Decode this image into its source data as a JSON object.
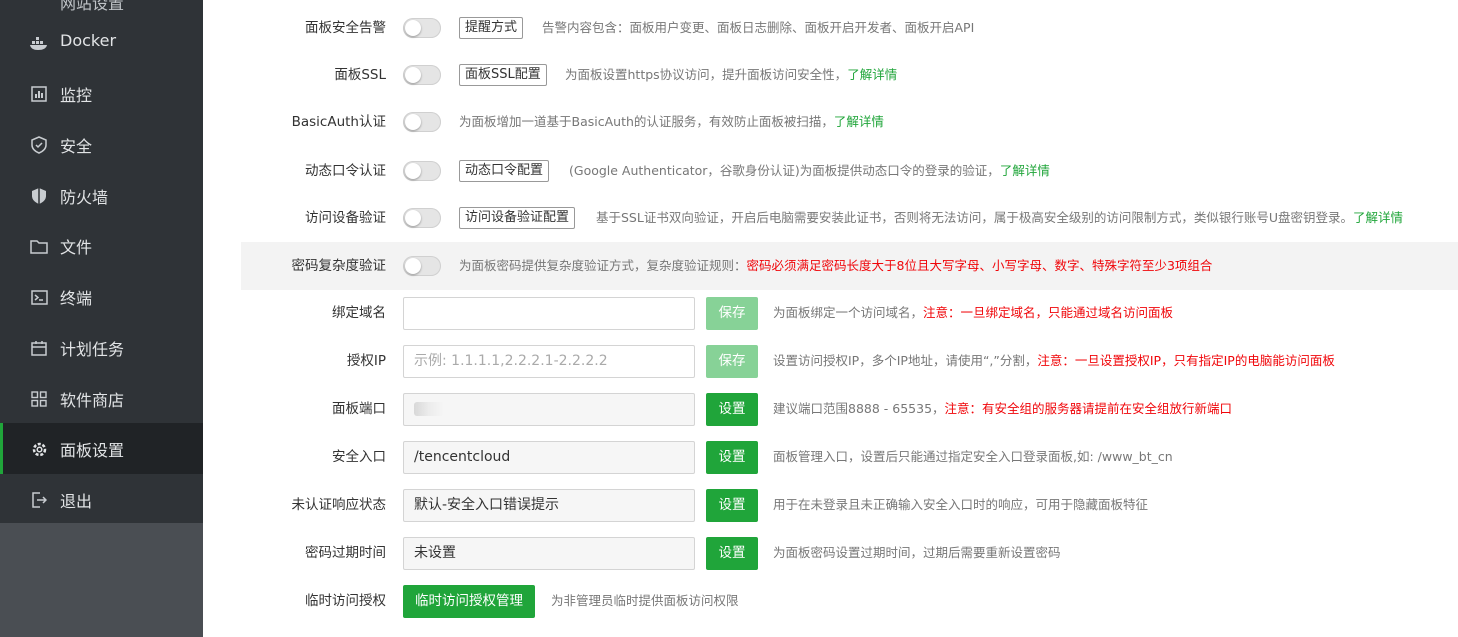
{
  "sidebar": {
    "top_partial": "网站设置",
    "items": [
      {
        "label": "Docker",
        "icon": "docker-icon"
      },
      {
        "label": "监控",
        "icon": "monitor-icon"
      },
      {
        "label": "安全",
        "icon": "shield-icon"
      },
      {
        "label": "防火墙",
        "icon": "firewall-icon"
      },
      {
        "label": "文件",
        "icon": "folder-icon"
      },
      {
        "label": "终端",
        "icon": "terminal-icon"
      },
      {
        "label": "计划任务",
        "icon": "calendar-icon"
      },
      {
        "label": "软件商店",
        "icon": "grid-icon"
      },
      {
        "label": "面板设置",
        "icon": "gear-icon",
        "active": true
      },
      {
        "label": "退出",
        "icon": "logout-icon"
      }
    ]
  },
  "settings": {
    "alert": {
      "label": "面板安全告警",
      "button": "提醒方式",
      "desc": "告警内容包含：面板用户变更、面板日志删除、面板开启开发者、面板开启API"
    },
    "ssl": {
      "label": "面板SSL",
      "button": "面板SSL配置",
      "desc": "为面板设置https协议访问，提升面板访问安全性，",
      "link": "了解详情"
    },
    "basicauth": {
      "label": "BasicAuth认证",
      "desc": "为面板增加一道基于BasicAuth的认证服务，有效防止面板被扫描，",
      "link": "了解详情"
    },
    "twofa": {
      "label": "动态口令认证",
      "button": "动态口令配置",
      "desc": "(Google Authenticator，谷歌身份认证)为面板提供动态口令的登录的验证，",
      "link": "了解详情"
    },
    "device": {
      "label": "访问设备验证",
      "button": "访问设备验证配置",
      "desc": "基于SSL证书双向验证，开启后电脑需要安装此证书，否则将无法访问，属于极高安全级别的访问限制方式，类似银行账号U盘密钥登录。",
      "link": "了解详情"
    },
    "pwd_complex": {
      "label": "密码复杂度验证",
      "desc": "为面板密码提供复杂度验证方式，复杂度验证规则：",
      "warn": "密码必须满足密码长度大于8位且大写字母、小写字母、数字、特殊字符至少3项组合"
    },
    "domain": {
      "label": "绑定域名",
      "value": "",
      "button": "保存",
      "desc": "为面板绑定一个访问域名，",
      "warn": "注意：一旦绑定域名，只能通过域名访问面板"
    },
    "ip": {
      "label": "授权IP",
      "placeholder": "示例: 1.1.1.1,2.2.2.1-2.2.2.2",
      "button": "保存",
      "desc": "设置访问授权IP，多个IP地址，请使用“,”分割，",
      "warn": "注意：一旦设置授权IP，只有指定IP的电脑能访问面板"
    },
    "port": {
      "label": "面板端口",
      "button": "设置",
      "desc": "建议端口范围8888 - 65535，",
      "warn": "注意：有安全组的服务器请提前在安全组放行新端口"
    },
    "entry": {
      "label": "安全入口",
      "value": "/tencentcloud",
      "button": "设置",
      "desc": "面板管理入口，设置后只能通过指定安全入口登录面板,如: /www_bt_cn"
    },
    "unauth": {
      "label": "未认证响应状态",
      "value": "默认-安全入口错误提示",
      "button": "设置",
      "desc": "用于在未登录且未正确输入安全入口时的响应，可用于隐藏面板特征"
    },
    "pwd_expire": {
      "label": "密码过期时间",
      "value": "未设置",
      "button": "设置",
      "desc": "为面板密码设置过期时间，过期后需要重新设置密码"
    },
    "temp_access": {
      "label": "临时访问授权",
      "button": "临时访问授权管理",
      "desc": "为非管理员临时提供面板访问权限"
    }
  },
  "colors": {
    "accent": "#20a53a",
    "warn": "#f0060a",
    "sidebar": "#2f3337"
  }
}
